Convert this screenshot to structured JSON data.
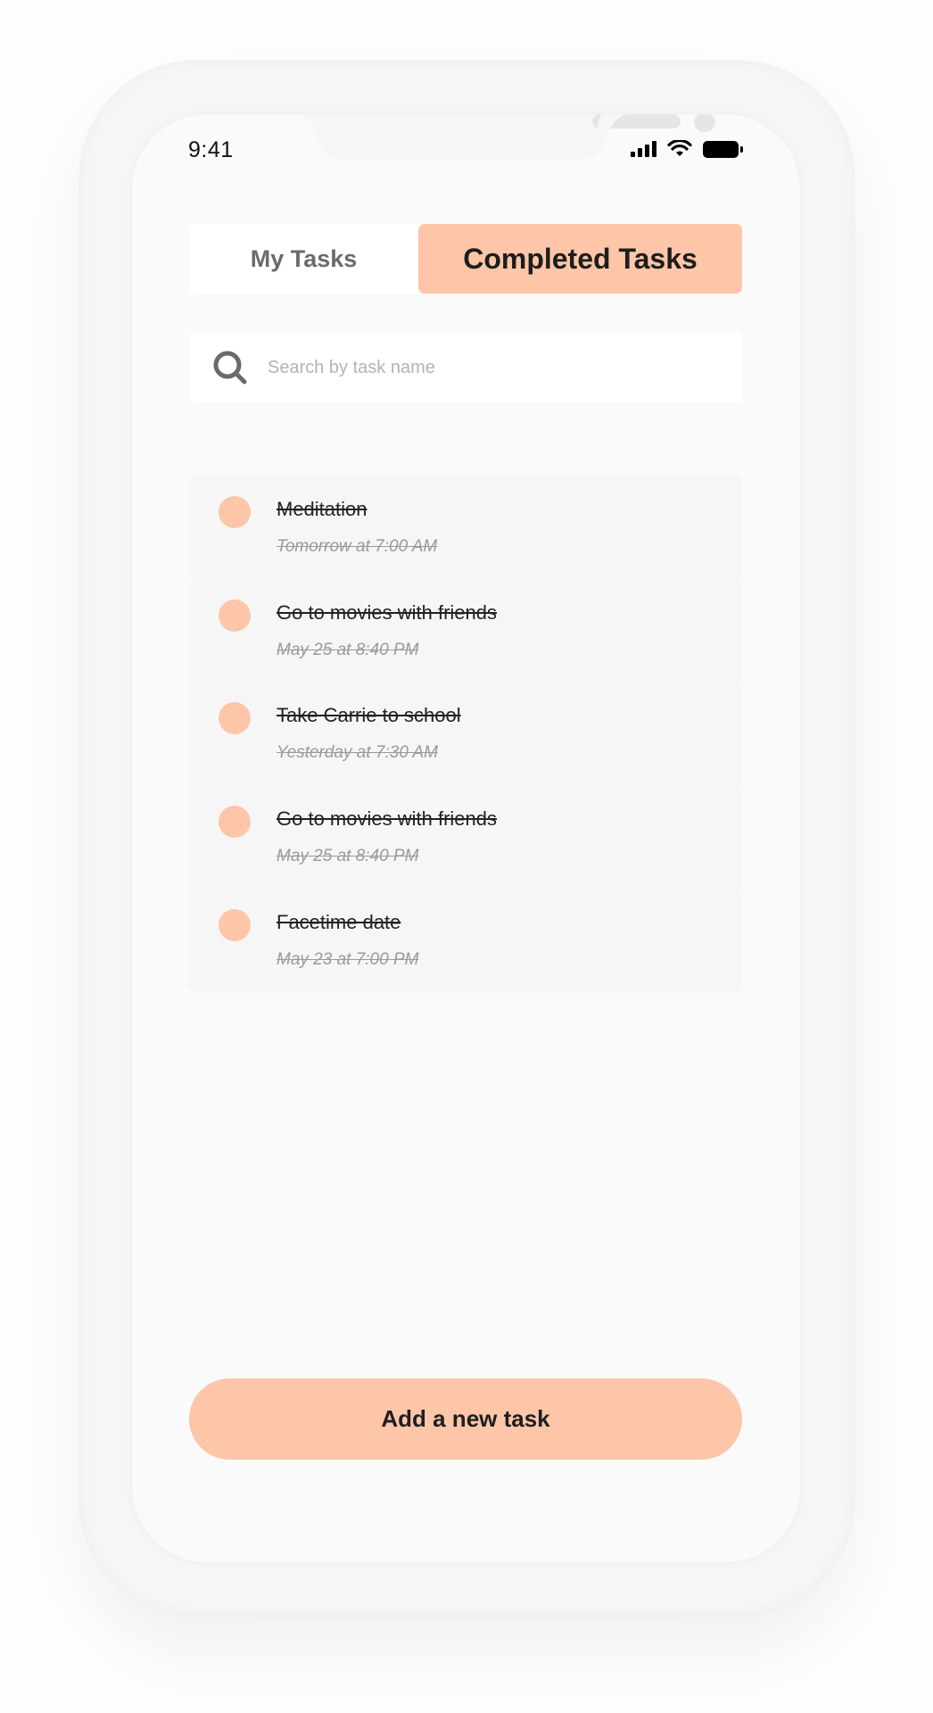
{
  "status_bar": {
    "time": "9:41",
    "icons": [
      "cellular-signal-icon",
      "wifi-icon",
      "battery-icon"
    ]
  },
  "tabs": [
    {
      "label": "My Tasks",
      "active": false
    },
    {
      "label": "Completed Tasks",
      "active": true
    }
  ],
  "search": {
    "placeholder": "Search by task name",
    "value": "",
    "icon": "search-icon"
  },
  "tasks": [
    {
      "title": "Meditation",
      "date": "Tomorrow at 7:00 AM",
      "completed": true
    },
    {
      "title": "Go to movies with friends",
      "date": "May 25 at 8:40 PM",
      "completed": true
    },
    {
      "title": "Take Carrie to school",
      "date": "Yesterday at 7:30 AM",
      "completed": true
    },
    {
      "title": "Go to movies with friends",
      "date": "May 25 at 8:40 PM",
      "completed": true
    },
    {
      "title": "Facetime date",
      "date": "May 23 at 7:00 PM",
      "completed": true
    }
  ],
  "add_button": {
    "label": "Add a new task"
  },
  "colors": {
    "accent": "#fdc6a8",
    "screen_background": "#fafafa",
    "text_primary": "#1d1d1d",
    "text_muted": "#9a9a9a"
  }
}
